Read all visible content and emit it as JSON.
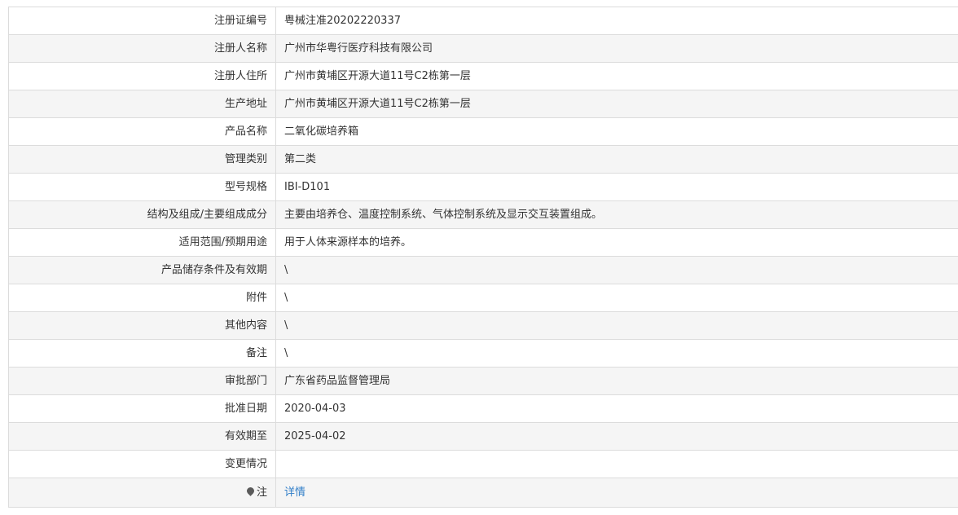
{
  "rows": [
    {
      "label": "注册证编号",
      "value": "粤械注准20202220337"
    },
    {
      "label": "注册人名称",
      "value": "广州市华粤行医疗科技有限公司"
    },
    {
      "label": "注册人住所",
      "value": "广州市黄埔区开源大道11号C2栋第一层"
    },
    {
      "label": "生产地址",
      "value": "广州市黄埔区开源大道11号C2栋第一层"
    },
    {
      "label": "产品名称",
      "value": "二氧化碳培养箱"
    },
    {
      "label": "管理类别",
      "value": "第二类"
    },
    {
      "label": "型号规格",
      "value": "IBI-D101"
    },
    {
      "label": "结构及组成/主要组成成分",
      "value": "主要由培养仓、温度控制系统、气体控制系统及显示交互装置组成。"
    },
    {
      "label": "适用范围/预期用途",
      "value": "用于人体来源样本的培养。"
    },
    {
      "label": "产品储存条件及有效期",
      "value": "\\"
    },
    {
      "label": "附件",
      "value": "\\"
    },
    {
      "label": "其他内容",
      "value": "\\"
    },
    {
      "label": "备注",
      "value": "\\"
    },
    {
      "label": "审批部门",
      "value": "广东省药品监督管理局"
    },
    {
      "label": "批准日期",
      "value": "2020-04-03"
    },
    {
      "label": "有效期至",
      "value": "2025-04-02"
    },
    {
      "label": "变更情况",
      "value": ""
    }
  ],
  "note": {
    "icon": "pin-icon",
    "label": "注",
    "link_text": "详情",
    "link_color": "#2f7dc8"
  }
}
